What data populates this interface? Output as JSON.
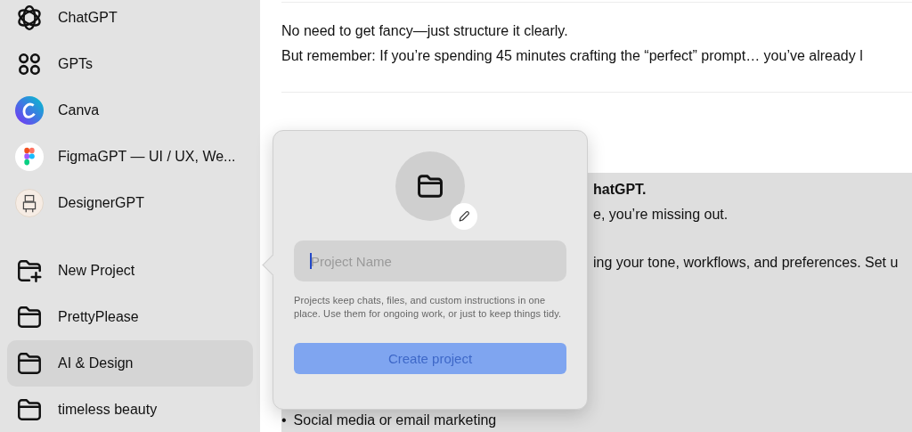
{
  "sidebar": {
    "items": [
      {
        "label": "ChatGPT",
        "kind": "chatgpt",
        "selected": false
      },
      {
        "label": "GPTs",
        "kind": "grid",
        "selected": false
      },
      {
        "label": "Canva",
        "kind": "canva",
        "selected": false
      },
      {
        "label": "FigmaGPT — UI / UX, We...",
        "kind": "figma",
        "selected": false
      },
      {
        "label": "DesignerGPT",
        "kind": "robot",
        "selected": false
      },
      {
        "label": "New Project",
        "kind": "new-folder",
        "selected": false
      },
      {
        "label": "PrettyPlease",
        "kind": "folder",
        "selected": false
      },
      {
        "label": "AI & Design",
        "kind": "folder",
        "selected": true
      },
      {
        "label": "timeless beauty",
        "kind": "folder",
        "selected": false
      }
    ]
  },
  "chat": {
    "paragraphs": [
      "No need to get fancy—just structure it clearly.",
      "But remember: If you’re spending 45 minutes crafting the “perfect” prompt… you’ve already l"
    ],
    "block_lines": [
      {
        "text": "hatGPT.",
        "bold": true
      },
      {
        "text": "e, you’re missing out.",
        "bold": false
      },
      {
        "text": "ing your tone, workflows, and preferences. Set u",
        "bold": false
      }
    ],
    "bullet": {
      "marker": "•",
      "text": "Social media or email marketing"
    }
  },
  "popup": {
    "name_field": {
      "placeholder": "Project Name"
    },
    "description": "Projects keep chats, files, and custom instructions in one place. Use them for ongoing work, or just to keep things tidy.",
    "button": {
      "label": "Create project",
      "disabled": true
    }
  }
}
